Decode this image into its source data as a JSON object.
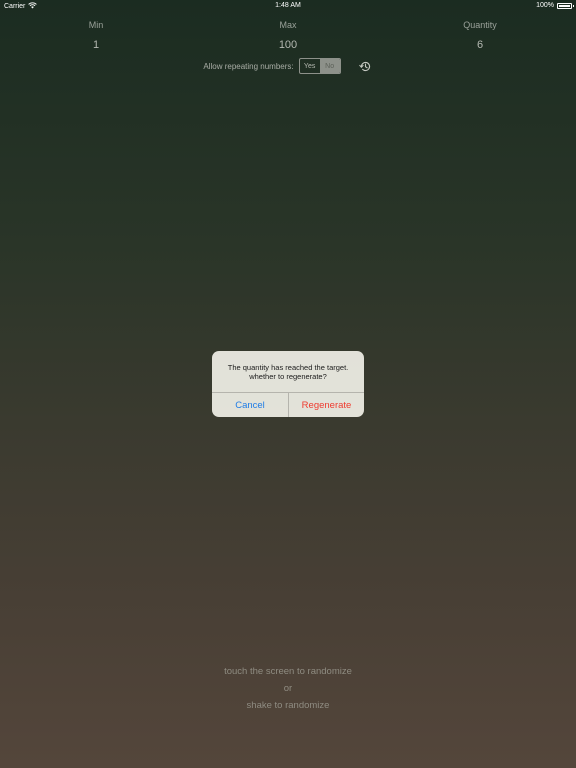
{
  "status_bar": {
    "carrier": "Carrier",
    "time": "1:48 AM",
    "battery": "100%"
  },
  "columns": {
    "min": {
      "label": "Min",
      "value": "1"
    },
    "max": {
      "label": "Max",
      "value": "100"
    },
    "quantity": {
      "label": "Quantity",
      "value": "6"
    }
  },
  "repeat": {
    "label": "Allow repeating numbers:",
    "yes": "Yes",
    "no": "No",
    "selected": "No"
  },
  "icons": {
    "wifi": "wifi-icon",
    "battery": "battery-icon",
    "history": "history-icon"
  },
  "alert": {
    "line1": "The quantity has reached the target.",
    "line2": "whether to regenerate?",
    "cancel": "Cancel",
    "regenerate": "Regenerate"
  },
  "colors": {
    "cancel": "#1f7ce6",
    "regenerate": "#ef3b2f"
  },
  "hints": {
    "touch": "touch the screen to randomize",
    "or": "or",
    "shake": "shake to randomize"
  }
}
